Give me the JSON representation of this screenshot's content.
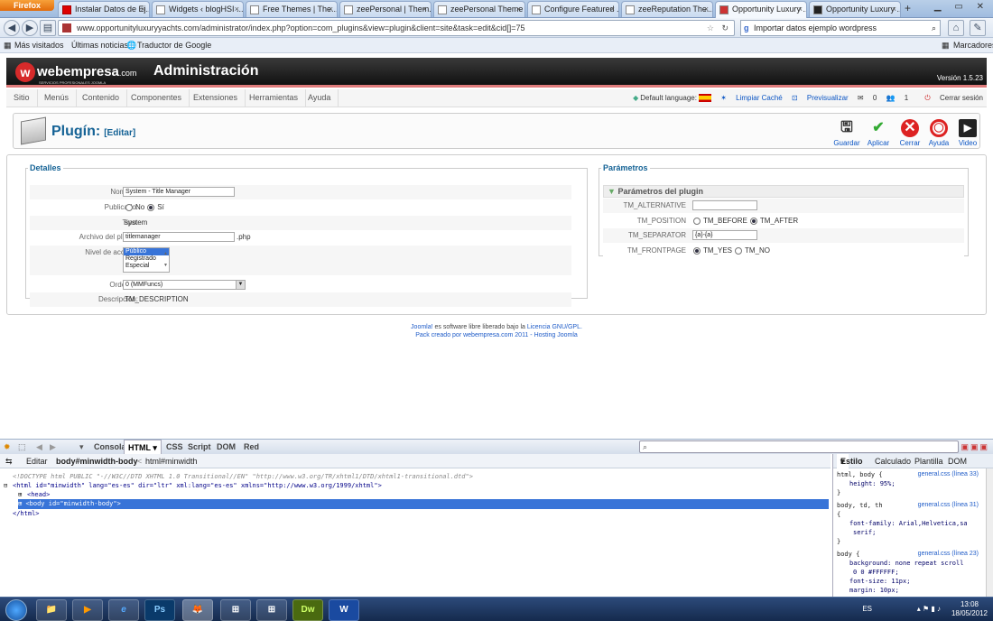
{
  "browser": {
    "app_button": "Firefox",
    "tabs": [
      {
        "title": "Instalar Datos de Ej..."
      },
      {
        "title": "Widgets ‹ blogHSI ..."
      },
      {
        "title": "Free Themes | The..."
      },
      {
        "title": "zeePersonal | Them..."
      },
      {
        "title": "zeePersonal Theme ..."
      },
      {
        "title": "Configure Featured ..."
      },
      {
        "title": "zeeReputation The..."
      },
      {
        "title": "Opportunity Luxury ..."
      },
      {
        "title": "Opportunity Luxury ..."
      }
    ],
    "url": "www.opportunityluxuryyachts.com/administrator/index.php?option=com_plugins&view=plugin&client=site&task=edit&cid[]=75",
    "search_value": "Importar datos ejemplo wordpress",
    "bookmarks": [
      "Más visitados",
      "Últimas noticias",
      "Traductor de Google"
    ],
    "bookmarks_menu": "Marcadores"
  },
  "joomla": {
    "logo_text": "webempresa",
    "logo_suffix": ".com",
    "logo_tagline": "SERVICIOS PROFESIONALES JOOMLA",
    "admin_title": "Administración",
    "version": "Versión 1.5.23",
    "menu": [
      "Sitio",
      "Menús",
      "Contenido",
      "Componentes",
      "Extensiones",
      "Herramientas",
      "Ayuda"
    ],
    "status": {
      "default_language": "Default language:",
      "clear_cache": "Limpiar Caché",
      "preview": "Previsualizar",
      "messages_count": "0",
      "users_count": "1",
      "logout": "Cerrar sesión"
    },
    "page_title": "Plugín:",
    "page_subtitle": "[Editar]",
    "toolbar": [
      "Guardar",
      "Aplicar",
      "Cerrar",
      "Ayuda",
      "Video"
    ],
    "details": {
      "legend": "Detalles",
      "name_label": "Nombre:",
      "name_value": "System - Title Manager",
      "published_label": "Publicado:",
      "published_no": "No",
      "published_yes": "Sí",
      "type_label": "Tipo:",
      "type_value": "system",
      "file_label": "Archivo del plugin:",
      "file_value": "titlemanager",
      "file_ext": ".php",
      "access_label": "Nivel de acceso:",
      "access_options": [
        "Público",
        "Registrado",
        "Especial"
      ],
      "access_selected": "Público",
      "order_label": "Ordenar:",
      "order_value": "0 (MMFuncs)",
      "description_label": "Descripción:",
      "description_value": "TM_DESCRIPTION"
    },
    "params": {
      "legend": "Parámetros",
      "header": "Parámetros del plugin",
      "alt_label": "TM_ALTERNATIVE",
      "alt_value": "",
      "pos_label": "TM_POSITION",
      "pos_before": "TM_BEFORE",
      "pos_after": "TM_AFTER",
      "sep_label": "TM_SEPARATOR",
      "sep_value": "{a}-{a}",
      "front_label": "TM_FRONTPAGE",
      "front_yes": "TM_YES",
      "front_no": "TM_NO"
    },
    "footer": {
      "joomla_link": "Joomla!",
      "text": " es software libre liberado bajo la ",
      "license_link": "Licencia GNU/GPL.",
      "line2": "Pack creado por webempresa.com 2011 - Hosting Joomla"
    }
  },
  "firebug": {
    "tabs": [
      "Consola",
      "HTML",
      "CSS",
      "Script",
      "DOM",
      "Red"
    ],
    "active_tab": "HTML",
    "edit_button": "Editar",
    "breadcrumb_1": "body#minwidth-body",
    "breadcrumb_2": "html#minwidth",
    "html_lines": [
      "<!DOCTYPE html PUBLIC \"-//W3C//DTD XHTML 1.0 Transitional//EN\" \"http://www.w3.org/TR/xhtml1/DTD/xhtml1-transitional.dtd\">",
      "<html id=\"minwidth\" lang=\"es-es\" dir=\"ltr\" xml:lang=\"es-es\" xmlns=\"http://www.w3.org/1999/xhtml\">",
      "<head>",
      "<body id=\"minwidth-body\">",
      "</html>"
    ],
    "side_tabs": [
      "Estilo",
      "Calculado",
      "Plantilla",
      "DOM"
    ],
    "css_rules": [
      {
        "selector": "html, body {",
        "source": "general.css (línea 33)",
        "props": [
          "height: 95%;"
        ]
      },
      {
        "selector": "body, td, th",
        "source": "general.css (línea 31)",
        "props": [
          "{",
          "font-family: Arial,Helvetica,sa",
          "serif;"
        ]
      },
      {
        "selector": "body {",
        "source": "general.css (línea 23)",
        "props": [
          "background: none repeat scroll",
          "0 0 #FFFFFF;",
          "font-size: 11px;",
          "margin: 10px;"
        ]
      }
    ]
  },
  "taskbar": {
    "apps": [
      "📁",
      "▶",
      "e",
      "Ps",
      "🦊",
      "⊞",
      "⊞",
      "Dw",
      "W"
    ],
    "lang": "ES",
    "time": "13:08",
    "date": "18/05/2012"
  },
  "colors": {
    "joomla_blue": "#146295",
    "link_blue": "#0b55c4",
    "header_dark": "#111111",
    "accent_red": "#e07c7c"
  }
}
